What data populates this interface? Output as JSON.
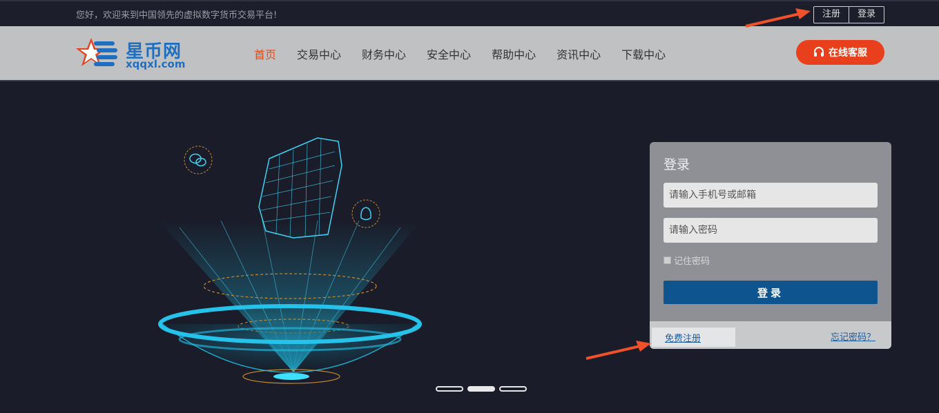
{
  "topbar": {
    "welcome": "您好，欢迎来到中国领先的虚拟数字货币交易平台!",
    "register": "注册",
    "login": "登录"
  },
  "brand": {
    "name_cn": "星币网",
    "domain": "xqqxl.com",
    "blue": "#1f6fc1",
    "red": "#e8401c"
  },
  "nav": {
    "items": [
      "首页",
      "交易中心",
      "财务中心",
      "安全中心",
      "帮助中心",
      "资讯中心",
      "下载中心"
    ],
    "active_index": 0,
    "service_label": "在线客服",
    "service_icon": "headset-icon"
  },
  "hero": {
    "icons": [
      "wechat-icon",
      "qq-icon"
    ],
    "slides": 3,
    "active_slide": 1
  },
  "login": {
    "title": "登录",
    "account_placeholder": "请输入手机号或邮箱",
    "password_placeholder": "请输入密码",
    "remember_label": "记住密码",
    "remember_checked": false,
    "submit_label": "登录",
    "register_link": "免费注册",
    "forgot_link": "忘记密码？"
  },
  "annotations": {
    "arrow_color": "#f0502a"
  }
}
